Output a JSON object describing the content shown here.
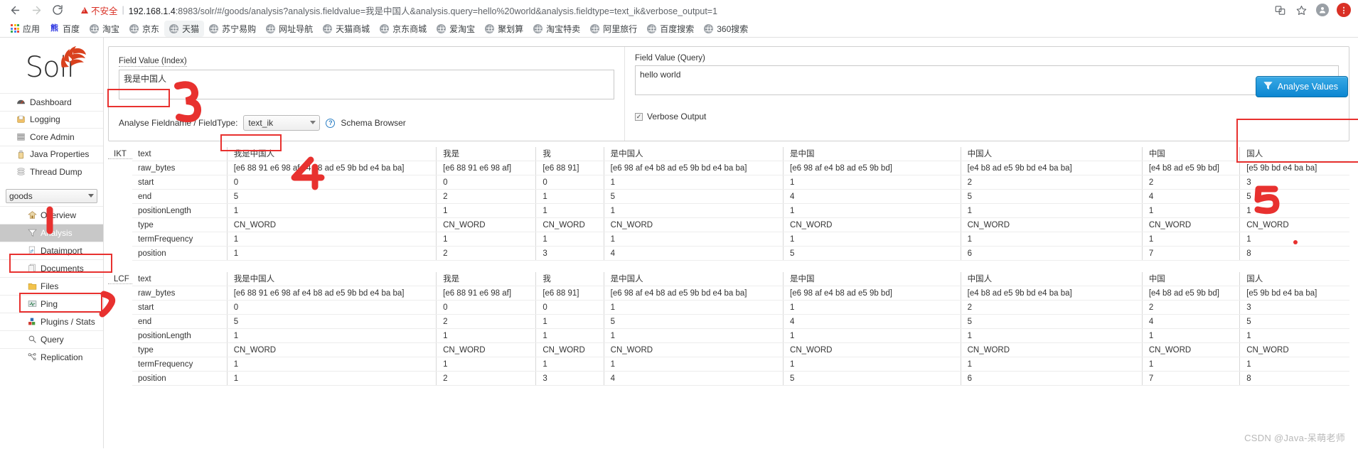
{
  "browser": {
    "back_icon": "back-arrow-icon",
    "forward_icon": "forward-arrow-icon",
    "reload_icon": "reload-icon",
    "security_label": "不安全",
    "url_host": "192.168.1.4",
    "url_rest": ":8983/solr/#/goods/analysis?analysis.fieldvalue=我是中国人&analysis.query=hello%20world&analysis.fieldtype=text_ik&verbose_output=1",
    "url_full": "192.168.1.4:8983/solr/#/goods/analysis?analysis.fieldvalue=我是中国人&analysis.query=hello%20world&analysis.fieldtype=text_ik&verbose_output=1",
    "translate_icon": "translate-icon",
    "bookmark_icon": "star-icon",
    "profile_icon": "profile-avatar-icon",
    "menu_icon": "chrome-menu-icon",
    "bookmarks": [
      {
        "label": "应用",
        "icon": "apps-grid-icon",
        "active": false
      },
      {
        "label": "百度",
        "icon": "baidu-icon",
        "active": false
      },
      {
        "label": "淘宝",
        "icon": "globe-icon",
        "active": false
      },
      {
        "label": "京东",
        "icon": "globe-icon",
        "active": false
      },
      {
        "label": "天猫",
        "icon": "globe-icon",
        "active": true
      },
      {
        "label": "苏宁易购",
        "icon": "globe-icon",
        "active": false
      },
      {
        "label": "网址导航",
        "icon": "globe-icon",
        "active": false
      },
      {
        "label": "天猫商城",
        "icon": "globe-icon",
        "active": false
      },
      {
        "label": "京东商城",
        "icon": "globe-icon",
        "active": false
      },
      {
        "label": "爱淘宝",
        "icon": "globe-icon",
        "active": false
      },
      {
        "label": "聚划算",
        "icon": "globe-icon",
        "active": false
      },
      {
        "label": "淘宝特卖",
        "icon": "globe-icon",
        "active": false
      },
      {
        "label": "阿里旅行",
        "icon": "globe-icon",
        "active": false
      },
      {
        "label": "百度搜索",
        "icon": "globe-icon",
        "active": false
      },
      {
        "label": "360搜索",
        "icon": "globe-icon",
        "active": false
      }
    ]
  },
  "sidebar": {
    "logo_text": "Solr",
    "global_items": [
      {
        "label": "Dashboard",
        "icon": "dashboard-gauge-icon"
      },
      {
        "label": "Logging",
        "icon": "logging-tray-icon"
      },
      {
        "label": "Core Admin",
        "icon": "core-admin-server-icon"
      },
      {
        "label": "Java Properties",
        "icon": "java-properties-icon"
      },
      {
        "label": "Thread Dump",
        "icon": "thread-dump-stack-icon"
      }
    ],
    "core_selector": {
      "value": "goods",
      "options": [
        "goods"
      ]
    },
    "core_items": [
      {
        "label": "Overview",
        "icon": "home-icon",
        "selected": false
      },
      {
        "label": "Analysis",
        "icon": "funnel-icon",
        "selected": true
      },
      {
        "label": "Dataimport",
        "icon": "dataimport-icon",
        "selected": false
      },
      {
        "label": "Documents",
        "icon": "documents-icon",
        "selected": false
      },
      {
        "label": "Files",
        "icon": "folder-icon",
        "selected": false
      },
      {
        "label": "Ping",
        "icon": "ping-monitor-icon",
        "selected": false
      },
      {
        "label": "Plugins / Stats",
        "icon": "plugins-blocks-icon",
        "selected": false
      },
      {
        "label": "Query",
        "icon": "magnifier-icon",
        "selected": false
      },
      {
        "label": "Replication",
        "icon": "replication-icon",
        "selected": false
      }
    ]
  },
  "form": {
    "index": {
      "label": "Field Value (Index)",
      "value": "我是中国人",
      "placeholder": ""
    },
    "query": {
      "label": "Field Value (Query)",
      "value": "hello world",
      "placeholder": ""
    },
    "fieldtype": {
      "label": "Analyse Fieldname / FieldType:",
      "value": "text_ik",
      "options": [
        "text_ik"
      ],
      "schema_browser_link": "Schema Browser",
      "help_icon": "question-mark-icon"
    },
    "verbose": {
      "label": "Verbose Output",
      "checked": true,
      "check_glyph": "✓"
    },
    "analyse_button": {
      "label": "Analyse Values",
      "icon": "funnel-icon",
      "color": "#0c86d1"
    }
  },
  "results": {
    "row_keys": [
      "text",
      "raw_bytes",
      "start",
      "end",
      "positionLength",
      "type",
      "termFrequency",
      "position"
    ],
    "analyzers": [
      {
        "tag": "IKT",
        "tokens": [
          {
            "text": "我是中国人",
            "raw_bytes": "[e6 88 91 e6 98 af e4 b8 ad e5 9b bd e4 ba ba]",
            "start": "0",
            "end": "5",
            "positionLength": "1",
            "type": "CN_WORD",
            "termFrequency": "1",
            "position": "1"
          },
          {
            "text": "我是",
            "raw_bytes": "[e6 88 91 e6 98 af]",
            "start": "0",
            "end": "2",
            "positionLength": "1",
            "type": "CN_WORD",
            "termFrequency": "1",
            "position": "2"
          },
          {
            "text": "我",
            "raw_bytes": "[e6 88 91]",
            "start": "0",
            "end": "1",
            "positionLength": "1",
            "type": "CN_WORD",
            "termFrequency": "1",
            "position": "3"
          },
          {
            "text": "是中国人",
            "raw_bytes": "[e6 98 af e4 b8 ad e5 9b bd e4 ba ba]",
            "start": "1",
            "end": "5",
            "positionLength": "1",
            "type": "CN_WORD",
            "termFrequency": "1",
            "position": "4"
          },
          {
            "text": "是中国",
            "raw_bytes": "[e6 98 af e4 b8 ad e5 9b bd]",
            "start": "1",
            "end": "4",
            "positionLength": "1",
            "type": "CN_WORD",
            "termFrequency": "1",
            "position": "5"
          },
          {
            "text": "中国人",
            "raw_bytes": "[e4 b8 ad e5 9b bd e4 ba ba]",
            "start": "2",
            "end": "5",
            "positionLength": "1",
            "type": "CN_WORD",
            "termFrequency": "1",
            "position": "6"
          },
          {
            "text": "中国",
            "raw_bytes": "[e4 b8 ad e5 9b bd]",
            "start": "2",
            "end": "4",
            "positionLength": "1",
            "type": "CN_WORD",
            "termFrequency": "1",
            "position": "7"
          },
          {
            "text": "国人",
            "raw_bytes": "[e5 9b bd e4 ba ba]",
            "start": "3",
            "end": "5",
            "positionLength": "1",
            "type": "CN_WORD",
            "termFrequency": "1",
            "position": "8"
          }
        ]
      },
      {
        "tag": "LCF",
        "tokens": [
          {
            "text": "我是中国人",
            "raw_bytes": "[e6 88 91 e6 98 af e4 b8 ad e5 9b bd e4 ba ba]",
            "start": "0",
            "end": "5",
            "positionLength": "1",
            "type": "CN_WORD",
            "termFrequency": "1",
            "position": "1"
          },
          {
            "text": "我是",
            "raw_bytes": "[e6 88 91 e6 98 af]",
            "start": "0",
            "end": "2",
            "positionLength": "1",
            "type": "CN_WORD",
            "termFrequency": "1",
            "position": "2"
          },
          {
            "text": "我",
            "raw_bytes": "[e6 88 91]",
            "start": "0",
            "end": "1",
            "positionLength": "1",
            "type": "CN_WORD",
            "termFrequency": "1",
            "position": "3"
          },
          {
            "text": "是中国人",
            "raw_bytes": "[e6 98 af e4 b8 ad e5 9b bd e4 ba ba]",
            "start": "1",
            "end": "5",
            "positionLength": "1",
            "type": "CN_WORD",
            "termFrequency": "1",
            "position": "4"
          },
          {
            "text": "是中国",
            "raw_bytes": "[e6 98 af e4 b8 ad e5 9b bd]",
            "start": "1",
            "end": "4",
            "positionLength": "1",
            "type": "CN_WORD",
            "termFrequency": "1",
            "position": "5"
          },
          {
            "text": "中国人",
            "raw_bytes": "[e4 b8 ad e5 9b bd e4 ba ba]",
            "start": "2",
            "end": "5",
            "positionLength": "1",
            "type": "CN_WORD",
            "termFrequency": "1",
            "position": "6"
          },
          {
            "text": "中国",
            "raw_bytes": "[e4 b8 ad e5 9b bd]",
            "start": "2",
            "end": "4",
            "positionLength": "1",
            "type": "CN_WORD",
            "termFrequency": "1",
            "position": "7"
          },
          {
            "text": "国人",
            "raw_bytes": "[e5 9b bd e4 ba ba]",
            "start": "3",
            "end": "5",
            "positionLength": "1",
            "type": "CN_WORD",
            "termFrequency": "1",
            "position": "8"
          }
        ]
      }
    ]
  },
  "annotations": {
    "color": "#e8312f",
    "marks": [
      "1",
      "2",
      "3",
      "4",
      "5"
    ]
  },
  "watermark": "CSDN @Java-呆萌老师"
}
